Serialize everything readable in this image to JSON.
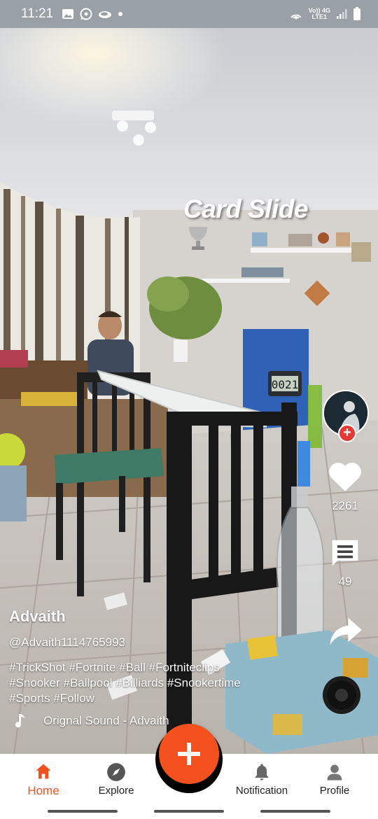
{
  "status_bar": {
    "time": "11:21",
    "left_icons": [
      "gallery-icon",
      "whatsapp-icon",
      "cloud-icon",
      "dot-icon"
    ],
    "right_icons": [
      "hotspot-icon",
      "volte-icon",
      "network-4g-icon",
      "signal-icon",
      "battery-icon"
    ],
    "net_label_top": "Vo)) 4G",
    "net_label_bottom": "LTE1"
  },
  "video": {
    "overlay_title": "Card Slide",
    "overlay_icon": "trophy-icon",
    "timer_display": "0021"
  },
  "actions": {
    "like_count": "2261",
    "comment_count": "49",
    "follow_symbol": "+"
  },
  "post": {
    "author_name": "Advaith",
    "author_handle": "@Advaith1114765993",
    "hashtag_lines": [
      "#TrickShot #Fortnite #Ball #Fortniteclips",
      "#Snooker #Ballpool #Billiards #Snookertime",
      "#Sports #Follow"
    ],
    "sound_label": "Orignal Sound - Advaith"
  },
  "nav": {
    "home": "Home",
    "explore": "Explore",
    "notification": "Notification",
    "profile": "Profile"
  },
  "colors": {
    "accent": "#f4511e",
    "follow_badge": "#e53935",
    "status_bar": "#9aa1a6"
  }
}
